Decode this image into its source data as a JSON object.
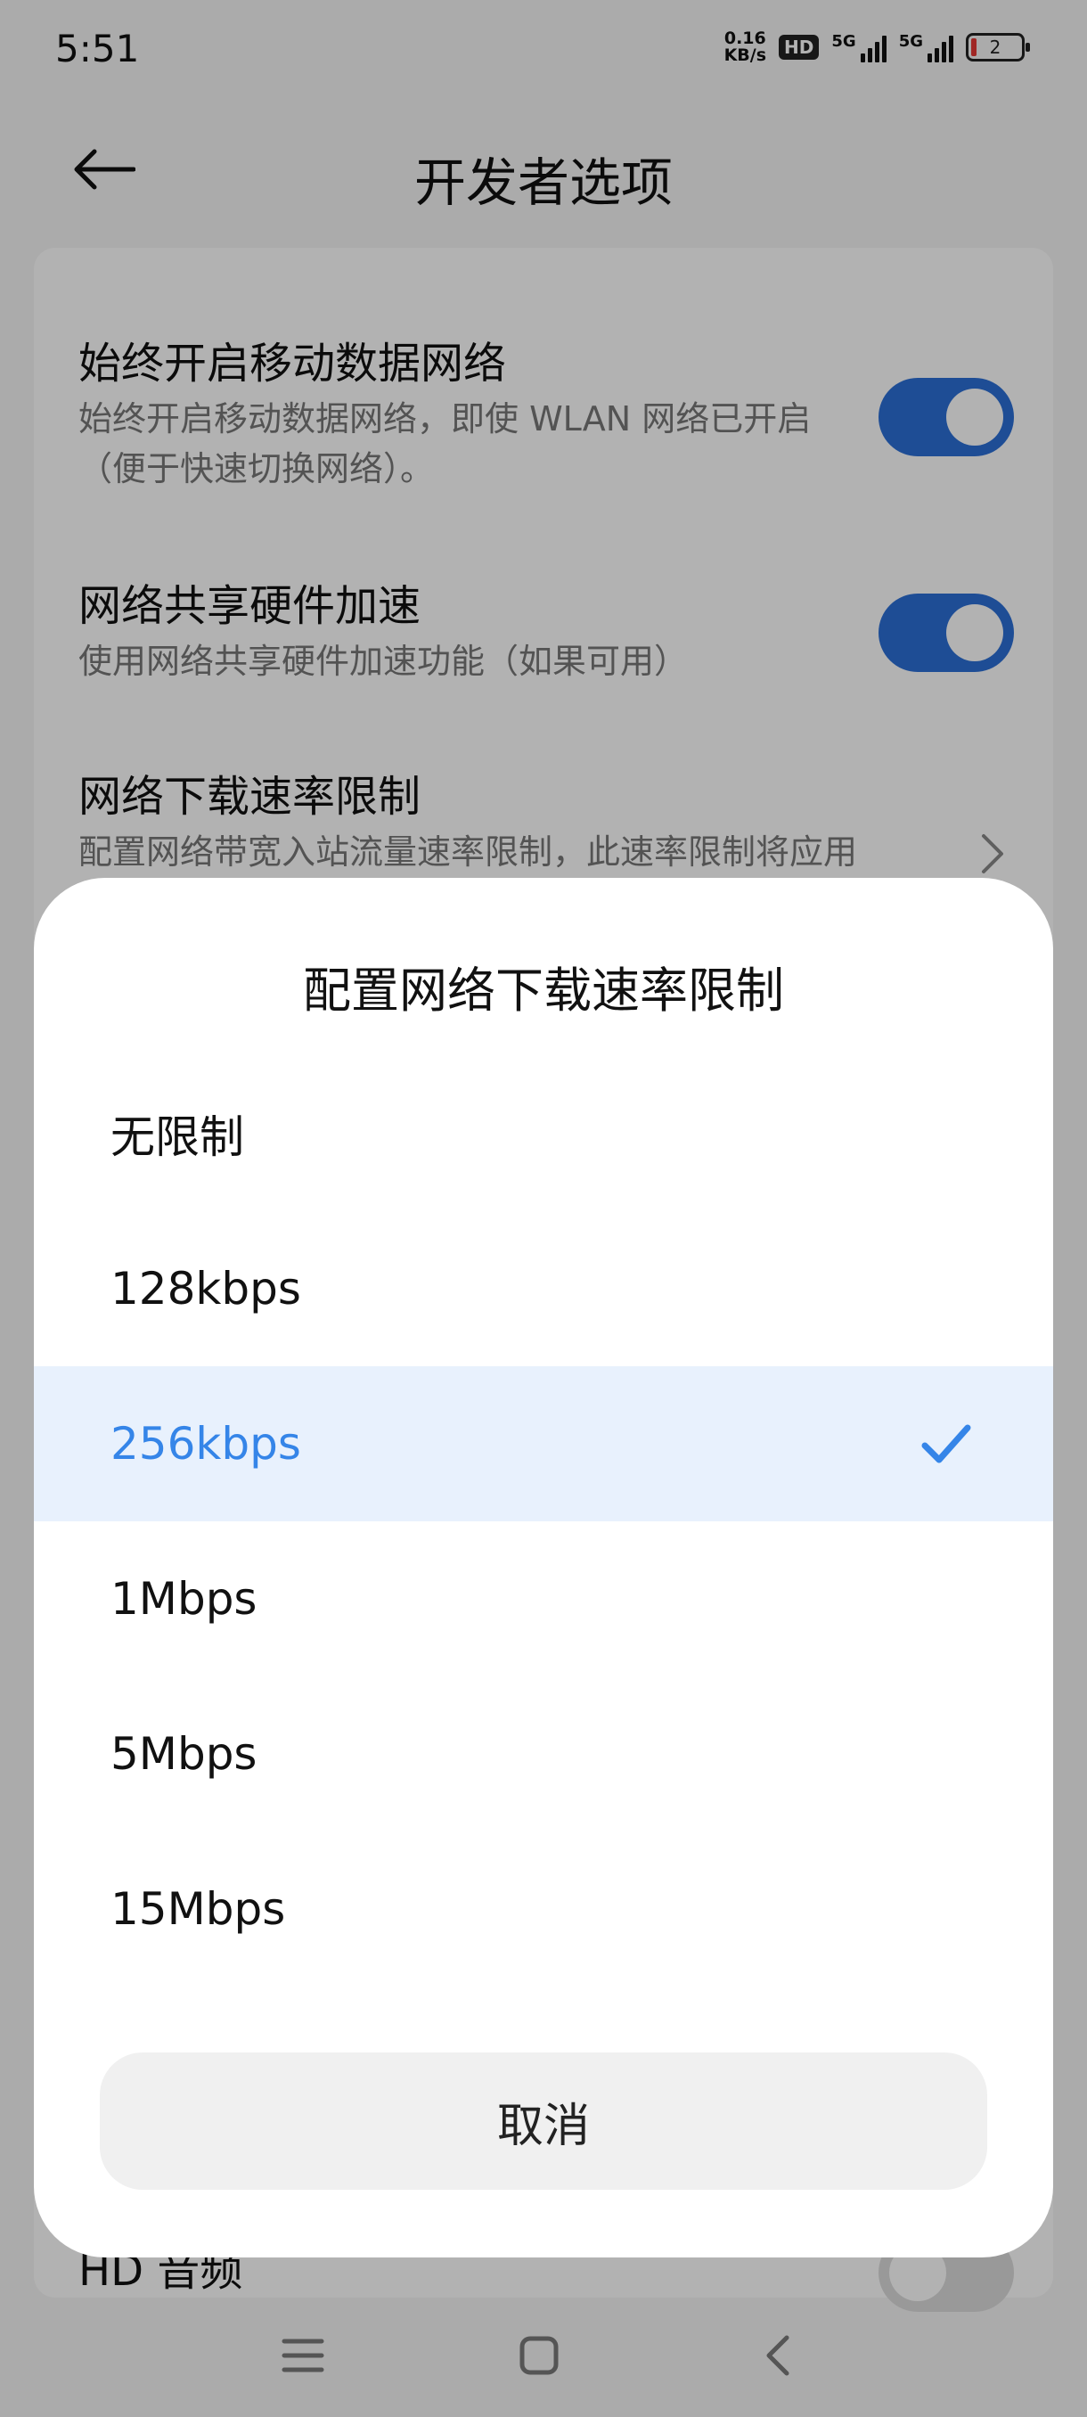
{
  "status_bar": {
    "time": "5:51",
    "net_speed_value": "0.16",
    "net_speed_unit": "KB/s",
    "hd_badge": "HD",
    "signal1_label": "5G",
    "signal2_label": "5G",
    "battery_level": "2"
  },
  "header": {
    "title": "开发者选项",
    "back_icon": "arrow-left-icon"
  },
  "settings": {
    "items": [
      {
        "title": "始终开启移动数据网络",
        "desc": "始终开启移动数据网络，即使 WLAN 网络已开启（便于快速切换网络）。",
        "toggle": "on"
      },
      {
        "title": "网络共享硬件加速",
        "desc": "使用网络共享硬件加速功能（如果可用）",
        "toggle": "on"
      },
      {
        "title": "网络下载速率限制",
        "desc": "配置网络带宽入站流量速率限制，此速率限制将应用",
        "control": "chevron-right-icon"
      },
      {
        "title": "HD 音频",
        "toggle": "off"
      }
    ]
  },
  "dialog": {
    "title": "配置网络下载速率限制",
    "options": [
      {
        "label": "无限制",
        "selected": false
      },
      {
        "label": "128kbps",
        "selected": false
      },
      {
        "label": "256kbps",
        "selected": true
      },
      {
        "label": "1Mbps",
        "selected": false
      },
      {
        "label": "5Mbps",
        "selected": false
      },
      {
        "label": "15Mbps",
        "selected": false
      }
    ],
    "cancel_label": "取消",
    "check_icon": "check-icon"
  },
  "nav_bar": {
    "buttons": [
      "menu-icon",
      "home-icon",
      "back-icon"
    ]
  },
  "colors": {
    "accent": "#3585e8",
    "toggle_on": "#2c6fd6",
    "selected_bg": "#e8f1fd",
    "scrim": "rgba(0,0,0,0.30)"
  }
}
